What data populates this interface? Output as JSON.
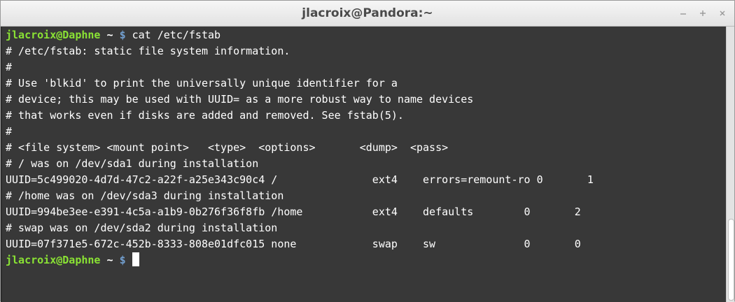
{
  "window": {
    "title": "jlacroix@Pandora:~"
  },
  "controls": {
    "minimize": "minimize-icon",
    "maximize": "maximize-icon",
    "close": "close-icon"
  },
  "prompt": {
    "user": "jlacroix@Daphne",
    "dir": " ~ ",
    "symbol": "$"
  },
  "terminal": {
    "command": " cat /etc/fstab",
    "lines": [
      "# /etc/fstab: static file system information.",
      "#",
      "# Use 'blkid' to print the universally unique identifier for a",
      "# device; this may be used with UUID= as a more robust way to name devices",
      "# that works even if disks are added and removed. See fstab(5).",
      "#",
      "# <file system> <mount point>   <type>  <options>       <dump>  <pass>",
      "# / was on /dev/sda1 during installation",
      "UUID=5c499020-4d7d-47c2-a22f-a25e343c90c4 /               ext4    errors=remount-ro 0       1",
      "# /home was on /dev/sda3 during installation",
      "UUID=994be3ee-e391-4c5a-a1b9-0b276f36f8fb /home           ext4    defaults        0       2",
      "# swap was on /dev/sda2 during installation",
      "UUID=07f371e5-672c-452b-8333-808e01dfc015 none            swap    sw              0       0"
    ]
  },
  "colors": {
    "background": "#383838",
    "text": "#ffffff",
    "prompt_user": "#8ae234",
    "prompt_dollar": "#729fcf"
  }
}
